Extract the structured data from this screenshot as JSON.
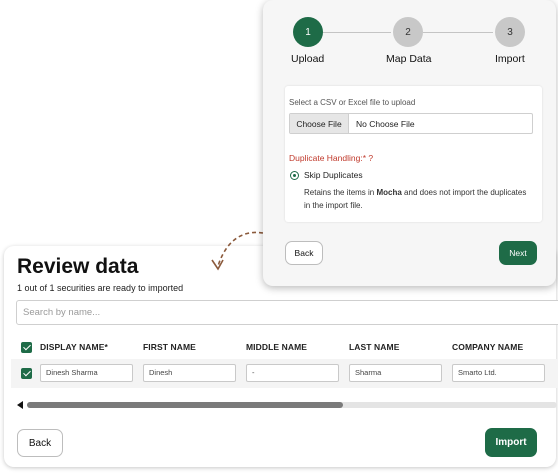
{
  "review": {
    "title": "Review data",
    "subtitle": "1 out of 1 securities are ready to imported",
    "search_placeholder": "Search by name...",
    "columns": [
      "DISPLAY NAME*",
      "FIRST NAME",
      "MIDDLE NAME",
      "LAST NAME",
      "COMPANY NAME"
    ],
    "rows": [
      {
        "display_name": "Dinesh Sharma",
        "first_name": "Dinesh",
        "middle_name": "-",
        "last_name": "Sharma",
        "company_name": "Smarto Ltd."
      }
    ],
    "back_label": "Back",
    "import_label": "Import",
    "scroll_position": 0.0
  },
  "wizard": {
    "steps": [
      {
        "number": "1",
        "label": "Upload",
        "state": "active"
      },
      {
        "number": "2",
        "label": "Map Data",
        "state": "inactive"
      },
      {
        "number": "3",
        "label": "Import",
        "state": "inactive"
      }
    ],
    "file_label": "Select a CSV or Excel file to upload",
    "choose_file_label": "Choose File",
    "file_name": "No Choose File",
    "duplicate_label": "Duplicate Handling:* ?",
    "option_label": "Skip Duplicates",
    "option_desc_pre": "Retains the items in ",
    "option_desc_bold": "Mocha",
    "option_desc_post": " and does not import the duplicates in the import file.",
    "back_label": "Back",
    "next_label": "Next"
  },
  "colors": {
    "accent": "#1e6b47",
    "warning": "#c0392b",
    "arrow": "#8b5a3c"
  }
}
